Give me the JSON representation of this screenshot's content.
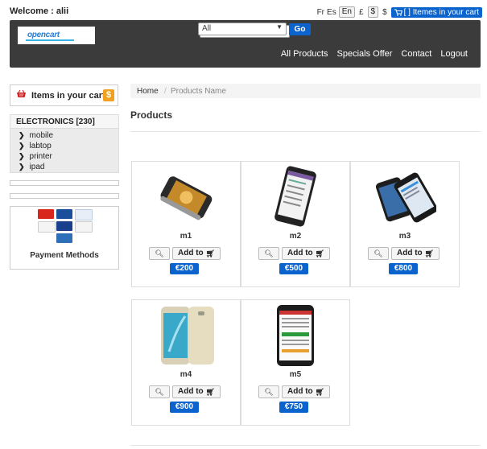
{
  "header": {
    "welcome": "Welcome : alii",
    "languages": [
      "Fr",
      "Es"
    ],
    "currencies": [
      "En",
      "£",
      "$",
      "$"
    ],
    "top_cart_label": "[ ] Itemes in your cart",
    "logo_text": "opencart",
    "search_value": "",
    "category_selected": "All",
    "go_label": "Go",
    "nav": [
      "All Products",
      "Specials Offer",
      "Contact",
      "Logout"
    ]
  },
  "sidebar": {
    "cart_label": "Items in your cart",
    "cart_badge": "$",
    "category_title": "ELECTRONICS [230]",
    "categories": [
      "mobile",
      "labtop",
      "printer",
      "ipad"
    ],
    "payment_caption": "Payment Methods",
    "payment_cards": [
      "MasterCard",
      "Maestro",
      "PayPal",
      "VISA",
      "Visa Electron",
      "Google",
      "American Express"
    ]
  },
  "breadcrumb": {
    "home": "Home",
    "separator": "/",
    "current": "Products Name"
  },
  "main": {
    "title": "Products",
    "add_label": "Add to",
    "products": [
      {
        "name": "m1",
        "price": "€200"
      },
      {
        "name": "m2",
        "price": "€500"
      },
      {
        "name": "m3",
        "price": "€800"
      },
      {
        "name": "m4",
        "price": "€900"
      },
      {
        "name": "m5",
        "price": "€750"
      }
    ]
  },
  "colors": {
    "accent": "#0b63ce",
    "header_bg": "#3b3b3b",
    "badge": "#f0a11f"
  },
  "icons": {
    "search": "magnifier-icon",
    "cart": "cart-icon",
    "zoom": "zoom-icon"
  }
}
